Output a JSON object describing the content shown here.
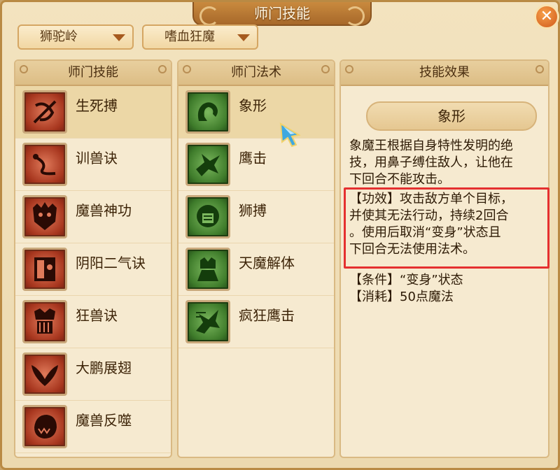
{
  "window": {
    "title": "师门技能",
    "close_symbol": "✕"
  },
  "dropdowns": [
    {
      "value": "狮驼岭"
    },
    {
      "value": "嗜血狂魔"
    }
  ],
  "panels": {
    "skills": {
      "header": "师门技能",
      "items": [
        {
          "label": "生死搏",
          "icon": "bow-slash-icon",
          "selected": true
        },
        {
          "label": "训兽诀",
          "icon": "whip-icon",
          "selected": false
        },
        {
          "label": "魔兽神功",
          "icon": "demon-face-icon",
          "selected": false
        },
        {
          "label": "阴阳二气诀",
          "icon": "yin-yang-mask-icon",
          "selected": false
        },
        {
          "label": "狂兽诀",
          "icon": "beast-fang-icon",
          "selected": false
        },
        {
          "label": "大鹏展翅",
          "icon": "wings-icon",
          "selected": false
        },
        {
          "label": "魔兽反噬",
          "icon": "beast-bite-icon",
          "selected": false
        }
      ]
    },
    "spells": {
      "header": "师门法术",
      "items": [
        {
          "label": "象形",
          "icon": "elephant-icon",
          "selected": true
        },
        {
          "label": "鹰击",
          "icon": "eagle-icon",
          "selected": false
        },
        {
          "label": "狮搏",
          "icon": "lion-icon",
          "selected": false
        },
        {
          "label": "天魔解体",
          "icon": "demon-body-icon",
          "selected": false
        },
        {
          "label": "疯狂鹰击",
          "icon": "frenzy-eagle-icon",
          "selected": false
        }
      ]
    },
    "effect": {
      "header": "技能效果",
      "skill_name": "象形",
      "description_lines": [
        "象魔王根据自身特性发明的绝",
        "技，用鼻子缚住敌人，让他在",
        "下回合不能攻击。"
      ],
      "effect_lines": [
        "【功效】攻击敌方单个目标，",
        "并使其无法行动，持续2回合",
        "。使用后取消“变身”状态且",
        "下回合无法使用法术。"
      ],
      "condition": "【条件】“变身”状态",
      "cost": "【消耗】50点魔法"
    }
  },
  "colors": {
    "highlight": "#e53030",
    "accent": "#c98a3e"
  }
}
